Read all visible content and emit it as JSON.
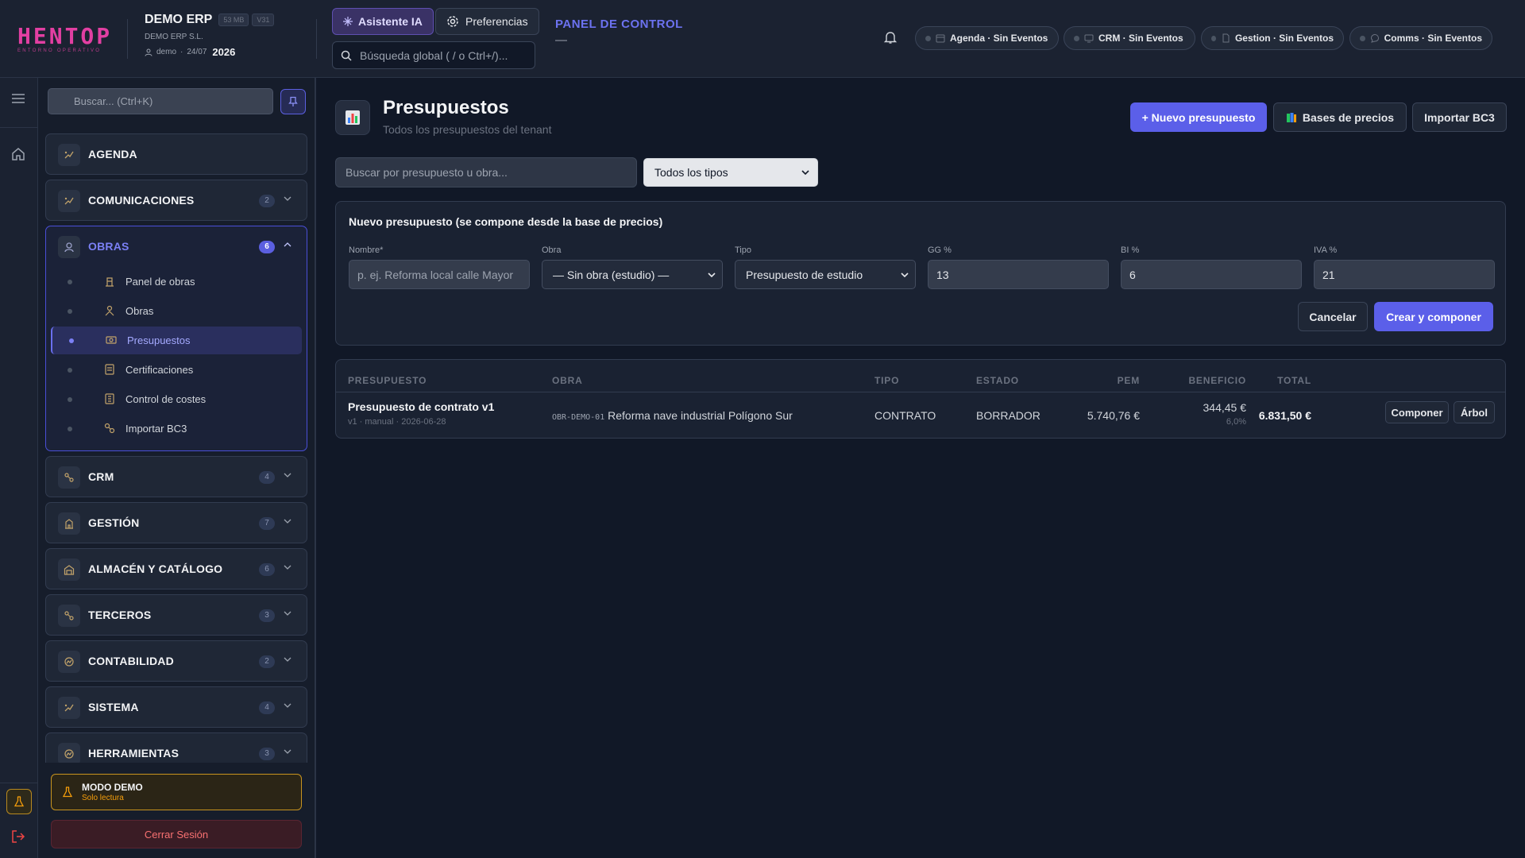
{
  "colors": {
    "accent": "#5b5fe9",
    "brand": "#e23fa2",
    "warning": "#c8941f",
    "danger": "#f87171"
  },
  "brand": {
    "logo": "HENTOP",
    "tagline": "ENTORNO OPERATIVO"
  },
  "header": {
    "app_name": "DEMO ERP",
    "size_badge": "53 MB",
    "version_badge": "V31",
    "company": "DEMO ERP S.L.",
    "user": "demo",
    "date": "24/07",
    "year": "2026",
    "ai_button": "Asistente IA",
    "prefs_button": "Preferencias",
    "search_placeholder": "Búsqueda global ( / o Ctrl+/)...",
    "panel_label": "PANEL DE CONTROL",
    "panel_value": "—",
    "chips": [
      {
        "label": "Agenda · Sin Eventos",
        "icon": "calendar-icon"
      },
      {
        "label": "CRM · Sin Eventos",
        "icon": "screen-icon"
      },
      {
        "label": "Gestion · Sin Eventos",
        "icon": "document-icon"
      },
      {
        "label": "Comms · Sin Eventos",
        "icon": "chat-icon"
      }
    ]
  },
  "sidebar": {
    "search_placeholder": "Buscar... (Ctrl+K)",
    "groups": [
      {
        "label": "AGENDA",
        "count": ""
      },
      {
        "label": "COMUNICACIONES",
        "count": "2"
      },
      {
        "label": "OBRAS",
        "count": "6"
      },
      {
        "label": "CRM",
        "count": "4"
      },
      {
        "label": "GESTIÓN",
        "count": "7"
      },
      {
        "label": "ALMACÉN Y CATÁLOGO",
        "count": "6"
      },
      {
        "label": "TERCEROS",
        "count": "3"
      },
      {
        "label": "CONTABILIDAD",
        "count": "2"
      },
      {
        "label": "SISTEMA",
        "count": "4"
      },
      {
        "label": "HERRAMIENTAS",
        "count": "3"
      }
    ],
    "obras_items": [
      {
        "label": "Panel de obras"
      },
      {
        "label": "Obras"
      },
      {
        "label": "Presupuestos",
        "active": true
      },
      {
        "label": "Certificaciones"
      },
      {
        "label": "Control de costes"
      },
      {
        "label": "Importar BC3"
      }
    ],
    "demo_title": "MODO DEMO",
    "demo_sub": "Solo lectura",
    "logout": "Cerrar Sesión"
  },
  "page": {
    "title": "Presupuestos",
    "subtitle": "Todos los presupuestos del tenant",
    "new_button": "+ Nuevo presupuesto",
    "prices_button": "Bases de precios",
    "import_button": "Importar BC3",
    "filter_placeholder": "Buscar por presupuesto u obra...",
    "type_filter": "Todos los tipos"
  },
  "form": {
    "title": "Nuevo presupuesto (se compone desde la base de precios)",
    "name_label": "Nombre*",
    "name_placeholder": "p. ej. Reforma local calle Mayor",
    "obra_label": "Obra",
    "obra_value": "— Sin obra (estudio) —",
    "tipo_label": "Tipo",
    "tipo_value": "Presupuesto de estudio",
    "gg_label": "GG %",
    "gg_value": "13",
    "bi_label": "BI %",
    "bi_value": "6",
    "iva_label": "IVA %",
    "iva_value": "21",
    "cancel": "Cancelar",
    "submit": "Crear y componer"
  },
  "table": {
    "headers": {
      "presupuesto": "PRESUPUESTO",
      "obra": "OBRA",
      "tipo": "TIPO",
      "estado": "ESTADO",
      "pem": "PEM",
      "beneficio": "BENEFICIO",
      "total": "TOTAL"
    },
    "rows": [
      {
        "name": "Presupuesto de contrato v1",
        "meta": "v1 · manual · 2026-06-28",
        "obra_code": "OBR-DEMO-01",
        "obra_name": "Reforma nave industrial Polígono Sur",
        "tipo": "CONTRATO",
        "estado": "BORRADOR",
        "pem": "5.740,76 €",
        "beneficio": "344,45 €",
        "beneficio_pct": "6,0%",
        "total": "6.831,50 €",
        "compose": "Componer",
        "tree": "Árbol"
      }
    ]
  }
}
